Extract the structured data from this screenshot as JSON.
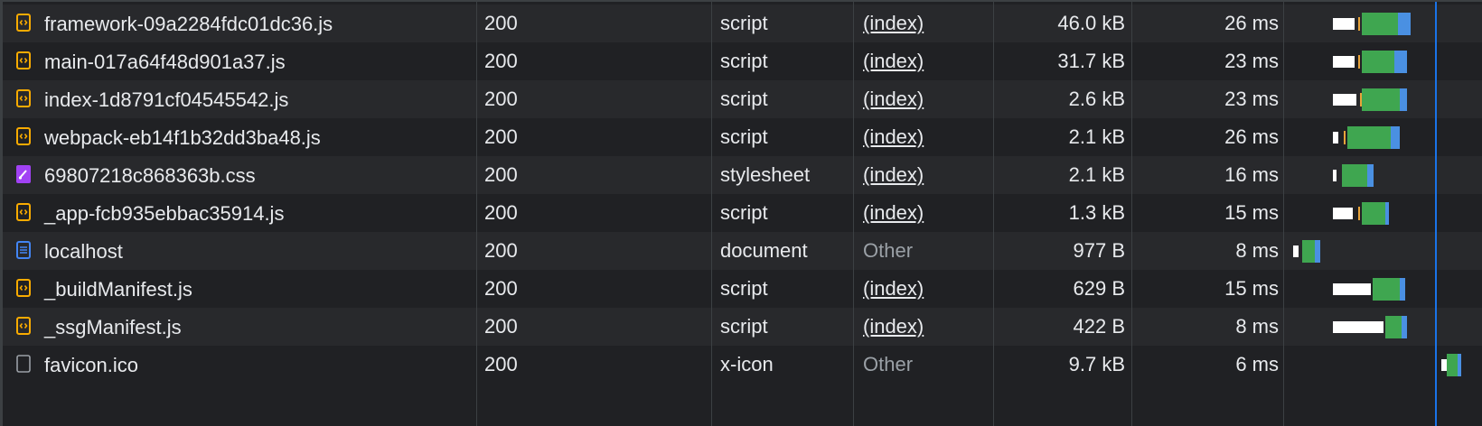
{
  "colors": {
    "script_icon": "#f9ab00",
    "stylesheet_icon": "#a142f4",
    "document_icon": "#4285f4",
    "other_icon": "#9aa0a6",
    "waterfall_receive": "#3fa650",
    "waterfall_download": "#4a90e2",
    "dom_content_line": "#1a73e8"
  },
  "rows": [
    {
      "name": "framework-09a2284fdc01dc36.js",
      "icon": "script-icon",
      "status": "200",
      "type": "script",
      "initiator": "(index)",
      "initiator_link": true,
      "size": "46.0 kB",
      "time": "26 ms"
    },
    {
      "name": "main-017a64f48d901a37.js",
      "icon": "script-icon",
      "status": "200",
      "type": "script",
      "initiator": "(index)",
      "initiator_link": true,
      "size": "31.7 kB",
      "time": "23 ms"
    },
    {
      "name": "index-1d8791cf04545542.js",
      "icon": "script-icon",
      "status": "200",
      "type": "script",
      "initiator": "(index)",
      "initiator_link": true,
      "size": "2.6 kB",
      "time": "23 ms"
    },
    {
      "name": "webpack-eb14f1b32dd3ba48.js",
      "icon": "script-icon",
      "status": "200",
      "type": "script",
      "initiator": "(index)",
      "initiator_link": true,
      "size": "2.1 kB",
      "time": "26 ms"
    },
    {
      "name": "69807218c868363b.css",
      "icon": "stylesheet-icon",
      "status": "200",
      "type": "stylesheet",
      "initiator": "(index)",
      "initiator_link": true,
      "size": "2.1 kB",
      "time": "16 ms"
    },
    {
      "name": "_app-fcb935ebbac35914.js",
      "icon": "script-icon",
      "status": "200",
      "type": "script",
      "initiator": "(index)",
      "initiator_link": true,
      "size": "1.3 kB",
      "time": "15 ms"
    },
    {
      "name": "localhost",
      "icon": "document-icon",
      "status": "200",
      "type": "document",
      "initiator": "Other",
      "initiator_link": false,
      "size": "977 B",
      "time": "8 ms"
    },
    {
      "name": "_buildManifest.js",
      "icon": "script-icon",
      "status": "200",
      "type": "script",
      "initiator": "(index)",
      "initiator_link": true,
      "size": "629 B",
      "time": "15 ms"
    },
    {
      "name": "_ssgManifest.js",
      "icon": "script-icon",
      "status": "200",
      "type": "script",
      "initiator": "(index)",
      "initiator_link": true,
      "size": "422 B",
      "time": "8 ms"
    },
    {
      "name": "favicon.ico",
      "icon": "generic-file-icon",
      "status": "200",
      "type": "x-icon",
      "initiator": "Other",
      "initiator_link": false,
      "size": "9.7 kB",
      "time": "6 ms"
    }
  ]
}
